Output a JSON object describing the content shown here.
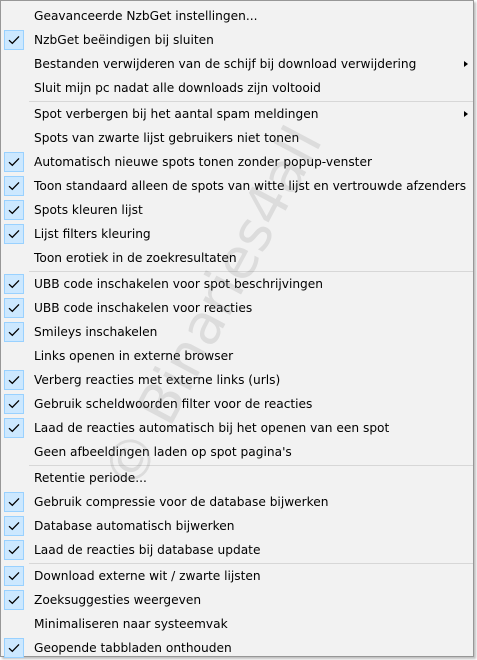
{
  "menu": {
    "groups": [
      {
        "items": [
          {
            "label": "Geavanceerde NzbGet instellingen...",
            "checked": false,
            "submenu": false
          },
          {
            "label": "NzbGet beëindigen bij sluiten",
            "checked": true,
            "submenu": false
          },
          {
            "label": "Bestanden verwijderen van de schijf bij download verwijdering",
            "checked": false,
            "submenu": true
          },
          {
            "label": "Sluit mijn pc nadat alle downloads zijn voltooid",
            "checked": false,
            "submenu": false
          }
        ]
      },
      {
        "items": [
          {
            "label": "Spot verbergen bij het aantal spam meldingen",
            "checked": false,
            "submenu": true
          },
          {
            "label": "Spots van zwarte lijst gebruikers niet tonen",
            "checked": false,
            "submenu": false
          },
          {
            "label": "Automatisch nieuwe spots tonen zonder popup-venster",
            "checked": true,
            "submenu": false
          },
          {
            "label": "Toon standaard alleen de spots van witte lijst en vertrouwde afzenders",
            "checked": true,
            "submenu": false
          },
          {
            "label": "Spots kleuren lijst",
            "checked": true,
            "submenu": false
          },
          {
            "label": "Lijst filters kleuring",
            "checked": true,
            "submenu": false
          },
          {
            "label": "Toon erotiek in de zoekresultaten",
            "checked": false,
            "submenu": false
          }
        ]
      },
      {
        "items": [
          {
            "label": "UBB code inschakelen  voor spot beschrijvingen",
            "checked": true,
            "submenu": false
          },
          {
            "label": "UBB code inschakelen voor reacties",
            "checked": true,
            "submenu": false
          },
          {
            "label": "Smileys inschakelen",
            "checked": true,
            "submenu": false
          },
          {
            "label": "Links openen in externe browser",
            "checked": false,
            "submenu": false
          },
          {
            "label": "Verberg reacties met externe links (urls)",
            "checked": true,
            "submenu": false
          },
          {
            "label": "Gebruik scheldwoorden filter voor de reacties",
            "checked": true,
            "submenu": false
          },
          {
            "label": "Laad de reacties automatisch bij het openen van een spot",
            "checked": true,
            "submenu": false
          },
          {
            "label": "Geen afbeeldingen laden op spot pagina's",
            "checked": false,
            "submenu": false
          }
        ]
      },
      {
        "items": [
          {
            "label": "Retentie periode...",
            "checked": false,
            "submenu": false
          },
          {
            "label": "Gebruik compressie voor de database bijwerken",
            "checked": true,
            "submenu": false
          },
          {
            "label": "Database automatisch bijwerken",
            "checked": true,
            "submenu": false
          },
          {
            "label": "Laad de reacties bij database update",
            "checked": true,
            "submenu": false
          }
        ]
      },
      {
        "items": [
          {
            "label": "Download externe wit / zwarte lijsten",
            "checked": true,
            "submenu": false
          },
          {
            "label": "Zoeksuggesties weergeven",
            "checked": true,
            "submenu": false
          },
          {
            "label": "Minimaliseren naar systeemvak",
            "checked": false,
            "submenu": false
          },
          {
            "label": "Geopende tabbladen onthouden",
            "checked": true,
            "submenu": false
          }
        ]
      }
    ]
  },
  "watermark": "© Binaries4all",
  "colors": {
    "check_bg": "#cce8ff",
    "check_border": "#99d1ff",
    "menu_bg": "#f2f2f2",
    "separator": "#d7d7d7"
  }
}
